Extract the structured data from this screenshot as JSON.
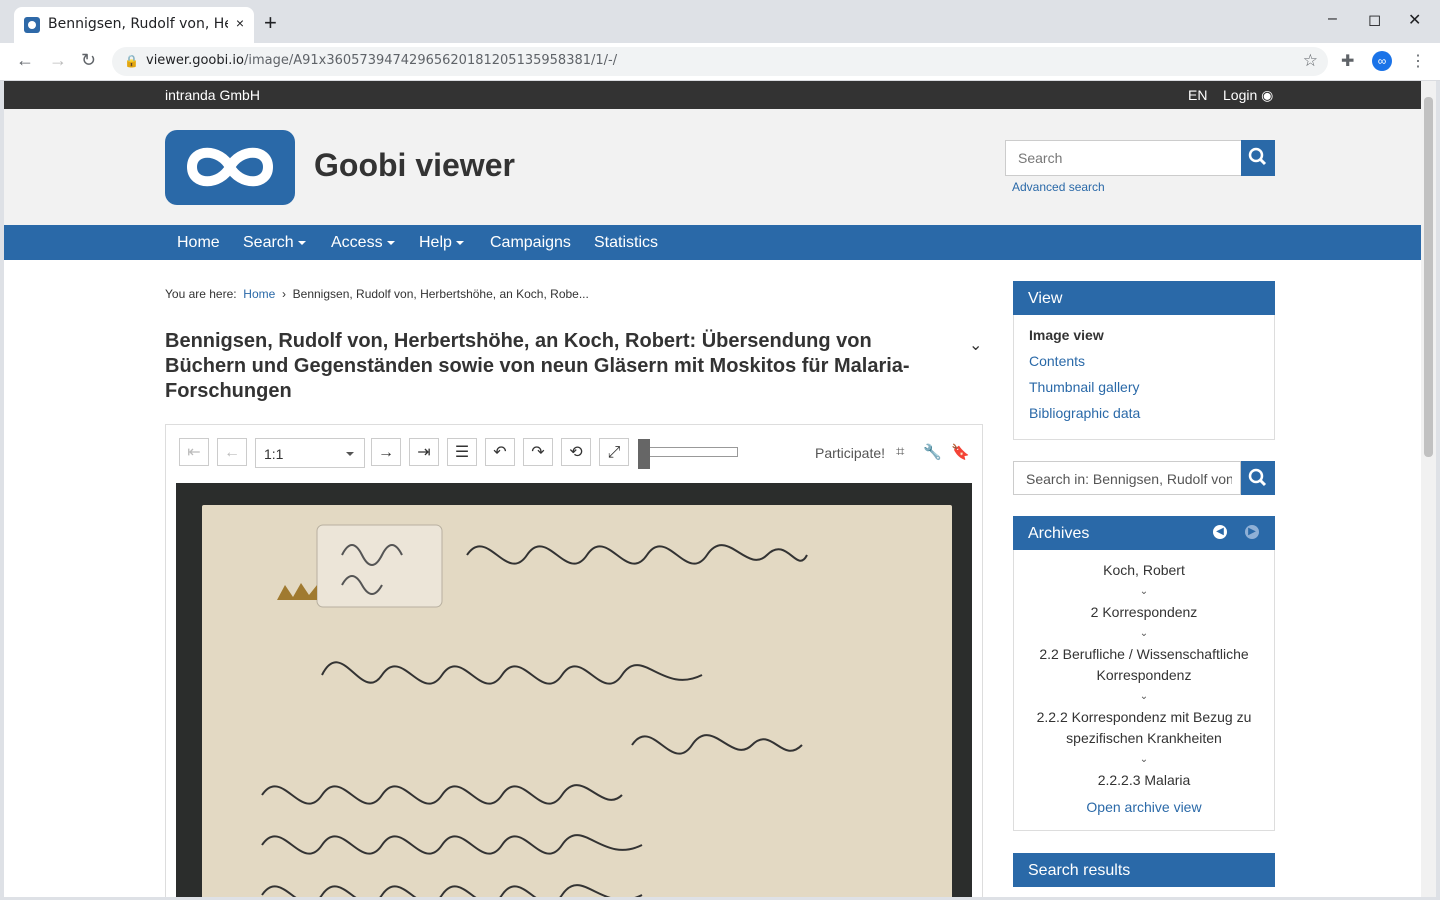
{
  "browser": {
    "tab_title": "Bennigsen, Rudolf von, He",
    "tab_close": "×",
    "new_tab": "+",
    "url_host": "viewer.goobi.io",
    "url_path": "/image/A91x36057394742965620181205135958381/1/-/",
    "controls": {
      "minimize": "–",
      "maximize": "◻",
      "close": "✕"
    }
  },
  "topbar": {
    "org": "intranda GmbH",
    "lang": "EN",
    "login": "Login"
  },
  "header": {
    "brand": "Goobi viewer",
    "search_placeholder": "Search",
    "advanced_search": "Advanced search"
  },
  "nav": {
    "home": "Home",
    "search": "Search",
    "access": "Access",
    "help": "Help",
    "campaigns": "Campaigns",
    "statistics": "Statistics"
  },
  "breadcrumb": {
    "prefix": "You are here:",
    "home": "Home",
    "sep": "›",
    "current": "Bennigsen, Rudolf von, Herbertshöhe, an Koch, Robe..."
  },
  "doc": {
    "title": "Bennigsen, Rudolf von, Herbertshöhe, an Koch, Robert: Übersendung von Büchern und Gegenständen sowie von neun Gläsern mit Moskitos für Malaria-Forschungen"
  },
  "viewer": {
    "zoom": "1:1",
    "participate": "Participate!",
    "slider_level": 0
  },
  "sidebar": {
    "view": {
      "title": "View",
      "items": [
        {
          "label": "Image view"
        },
        {
          "label": "Contents"
        },
        {
          "label": "Thumbnail gallery"
        },
        {
          "label": "Bibliographic data"
        }
      ]
    },
    "search_placeholder": "Search in: Bennigsen, Rudolf von",
    "archives": {
      "title": "Archives",
      "entries": [
        "Koch, Robert",
        "2 Korrespondenz",
        "2.2 Berufliche / Wissenschaftliche Korrespondenz",
        "2.2.2 Korrespondenz mit Bezug zu spezifischen Krankheiten",
        "2.2.2.3 Malaria"
      ],
      "open": "Open archive view"
    },
    "results": {
      "title": "Search results"
    }
  },
  "colors": {
    "brand": "#2a69a8",
    "topbar": "#333333",
    "header_bg": "#f2f2f2"
  }
}
